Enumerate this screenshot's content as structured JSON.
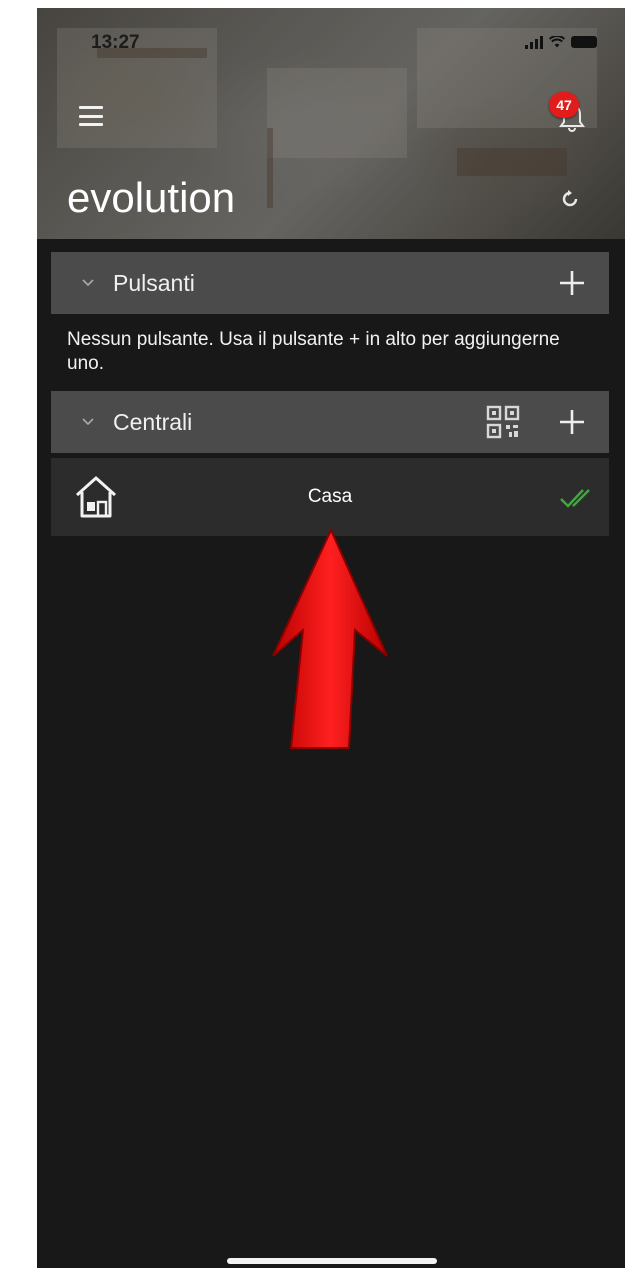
{
  "status_bar": {
    "time": "13:27"
  },
  "header": {
    "title": "evolution",
    "notification_count": "47",
    "icons": {
      "menu": "hamburger-menu-icon",
      "bell": "bell-icon",
      "refresh": "refresh-icon"
    }
  },
  "sections": {
    "buttons": {
      "label": "Pulsanti",
      "empty_message": "Nessun pulsante. Usa il pulsante + in alto per aggiungerne uno."
    },
    "panels": {
      "label": "Centrali",
      "items": [
        {
          "name": "Casa",
          "icon": "home-icon",
          "status_icon": "double-check-icon",
          "status_color": "#3fa83f"
        }
      ]
    }
  },
  "colors": {
    "badge": "#e21b1b",
    "section_bg": "#4b4b4b",
    "row_bg": "#2c2c2c",
    "screen_bg": "#181818",
    "annotation_arrow": "#e01010"
  }
}
